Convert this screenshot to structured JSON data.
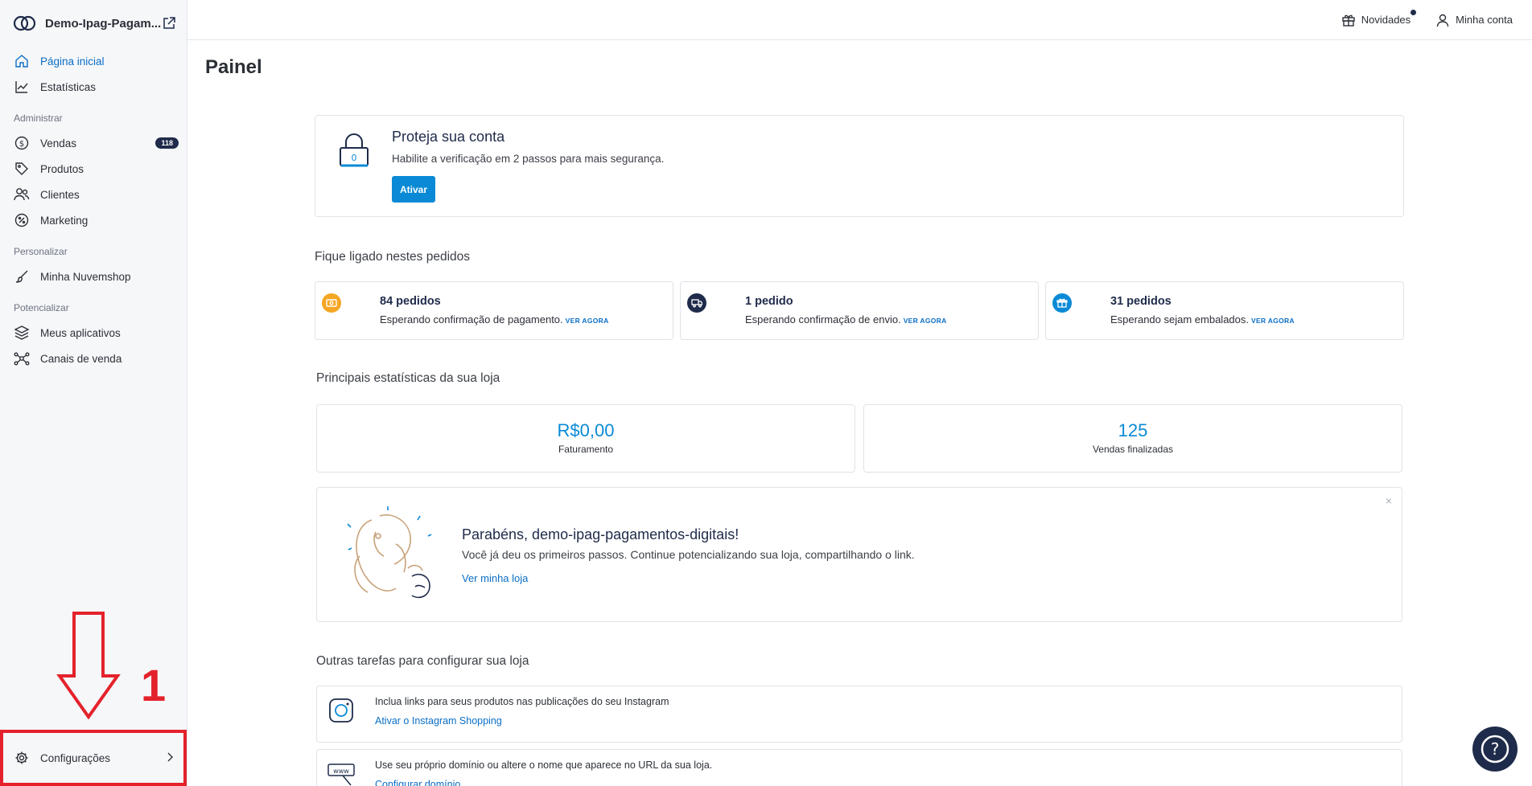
{
  "sidebar": {
    "store_name": "Demo-Ipag-Pagam...",
    "items_top": [
      {
        "label": "Página inicial",
        "icon": "home-icon",
        "active": true
      },
      {
        "label": "Estatísticas",
        "icon": "chart-icon",
        "active": false
      }
    ],
    "sections": [
      {
        "title": "Administrar",
        "items": [
          {
            "label": "Vendas",
            "icon": "dollar-icon",
            "badge": "118"
          },
          {
            "label": "Produtos",
            "icon": "tag-icon"
          },
          {
            "label": "Clientes",
            "icon": "users-icon"
          },
          {
            "label": "Marketing",
            "icon": "percent-icon"
          }
        ]
      },
      {
        "title": "Personalizar",
        "items": [
          {
            "label": "Minha Nuvemshop",
            "icon": "brush-icon"
          }
        ]
      },
      {
        "title": "Potencializar",
        "items": [
          {
            "label": "Meus aplicativos",
            "icon": "apps-icon"
          },
          {
            "label": "Canais de venda",
            "icon": "network-icon"
          }
        ]
      }
    ],
    "config_label": "Configurações",
    "annotation_number": "1"
  },
  "topbar": {
    "news_label": "Novidades",
    "account_label": "Minha conta"
  },
  "page_title": "Painel",
  "protect": {
    "title": "Proteja sua conta",
    "text": "Habilite a verificação em 2 passos para mais segurança.",
    "button": "Ativar"
  },
  "orders": {
    "title": "Fique ligado nestes pedidos",
    "cards": [
      {
        "count": "84 pedidos",
        "desc": "Esperando confirmação de pagamento.",
        "link": "VER AGORA",
        "color": "#f5a623"
      },
      {
        "count": "1 pedido",
        "desc": "Esperando confirmação de envio.",
        "link": "VER AGORA",
        "color": "#1f2b4a"
      },
      {
        "count": "31 pedidos",
        "desc": "Esperando sejam embalados.",
        "link": "VER AGORA",
        "color": "#0a8ad6"
      }
    ]
  },
  "stats": {
    "title": "Principais estatísticas da sua loja",
    "cards": [
      {
        "value": "R$0,00",
        "label": "Faturamento"
      },
      {
        "value": "125",
        "label": "Vendas finalizadas"
      }
    ]
  },
  "congrats": {
    "title": "Parabéns, demo-ipag-pagamentos-digitais!",
    "text": "Você já deu os primeiros passos. Continue potencializando sua loja, compartilhando o link.",
    "link": "Ver minha loja",
    "close": "×"
  },
  "tasks": {
    "title": "Outras tarefas para configurar sua loja",
    "items": [
      {
        "text": "Inclua links para seus produtos nas publicações do seu Instagram",
        "link": "Ativar o Instagram Shopping"
      },
      {
        "text": "Use seu próprio domínio ou altere o nome que aparece no URL da sua loja.",
        "link": "Configurar domínio"
      }
    ]
  },
  "help_label": "?"
}
